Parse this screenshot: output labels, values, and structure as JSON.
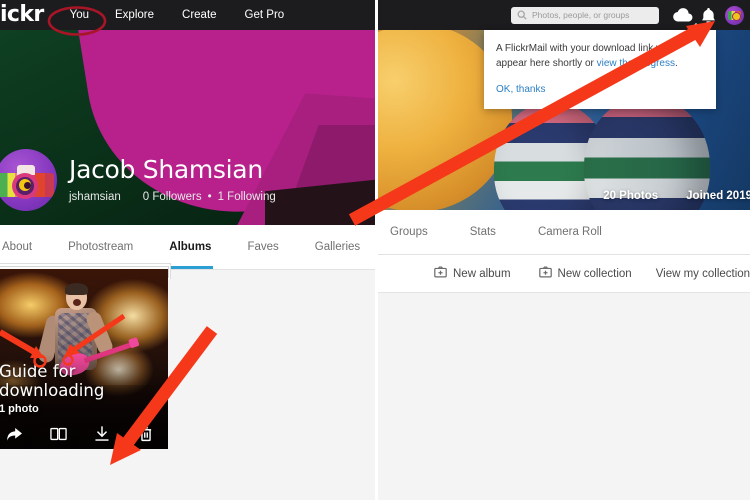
{
  "left_panel": {
    "navbar": {
      "logo": "lickr",
      "links": [
        {
          "label": "You",
          "circled": true
        },
        {
          "label": "Explore",
          "circled": false
        },
        {
          "label": "Create",
          "circled": false
        },
        {
          "label": "Get Pro",
          "circled": false
        }
      ]
    },
    "profile": {
      "display_name": "Jacob Shamsian",
      "username": "jshamsian",
      "followers": "0 Followers",
      "separator": "•",
      "following": "1 Following",
      "avatar_icon": "camera-avatar-icon"
    },
    "tabs": [
      {
        "label": "About",
        "active": false
      },
      {
        "label": "Photostream",
        "active": false
      },
      {
        "label": "Albums",
        "active": true
      },
      {
        "label": "Faves",
        "active": false
      },
      {
        "label": "Galleries",
        "active": false
      }
    ],
    "album_card": {
      "title": "Guide for downloading",
      "photo_count": "1 photo",
      "actions": [
        {
          "name": "share-icon",
          "label": "Share"
        },
        {
          "name": "album-book-icon",
          "label": "Album"
        },
        {
          "name": "download-icon",
          "label": "Download"
        },
        {
          "name": "trash-icon",
          "label": "Delete"
        }
      ]
    }
  },
  "right_panel": {
    "navbar": {
      "search_placeholder": "Photos, people, or groups",
      "search_value": "",
      "icons": [
        {
          "name": "cloud-upload-icon"
        },
        {
          "name": "bell-notifications-icon"
        },
        {
          "name": "user-avatar-icon"
        }
      ]
    },
    "banner_stats": [
      {
        "label": "20 Photos"
      },
      {
        "label": "Joined 2019"
      }
    ],
    "tabs": [
      {
        "label": "Groups",
        "active": false
      },
      {
        "label": "Stats",
        "active": false
      },
      {
        "label": "Camera Roll",
        "active": false
      }
    ],
    "action_bar": {
      "new_album": "New album",
      "new_collection": "New collection",
      "view_collections": "View my collections"
    },
    "popup": {
      "line1": "A FlickrMail with your download link will",
      "line2_pre": "appear here shortly or ",
      "line2_link": "view the progress",
      "line2_post": ".",
      "dismiss": "OK, thanks"
    }
  },
  "annotations": {
    "circle_color": "#a81526",
    "arrow_color": "#f5381a",
    "items": [
      {
        "name": "circle-you-nav",
        "shape": "ellipse"
      },
      {
        "name": "arrow-to-download-icon",
        "shape": "arrow"
      },
      {
        "name": "arrow-thumb-small-1",
        "shape": "arrow"
      },
      {
        "name": "arrow-thumb-small-2",
        "shape": "arrow"
      },
      {
        "name": "arrow-to-bell-icon",
        "shape": "arrow"
      }
    ]
  },
  "theme": {
    "nav_bg": "#1c1c1e",
    "accent_blue": "#2b9fd4",
    "link_blue": "#2b7fc4",
    "page_bg": "#f4f4f4"
  }
}
